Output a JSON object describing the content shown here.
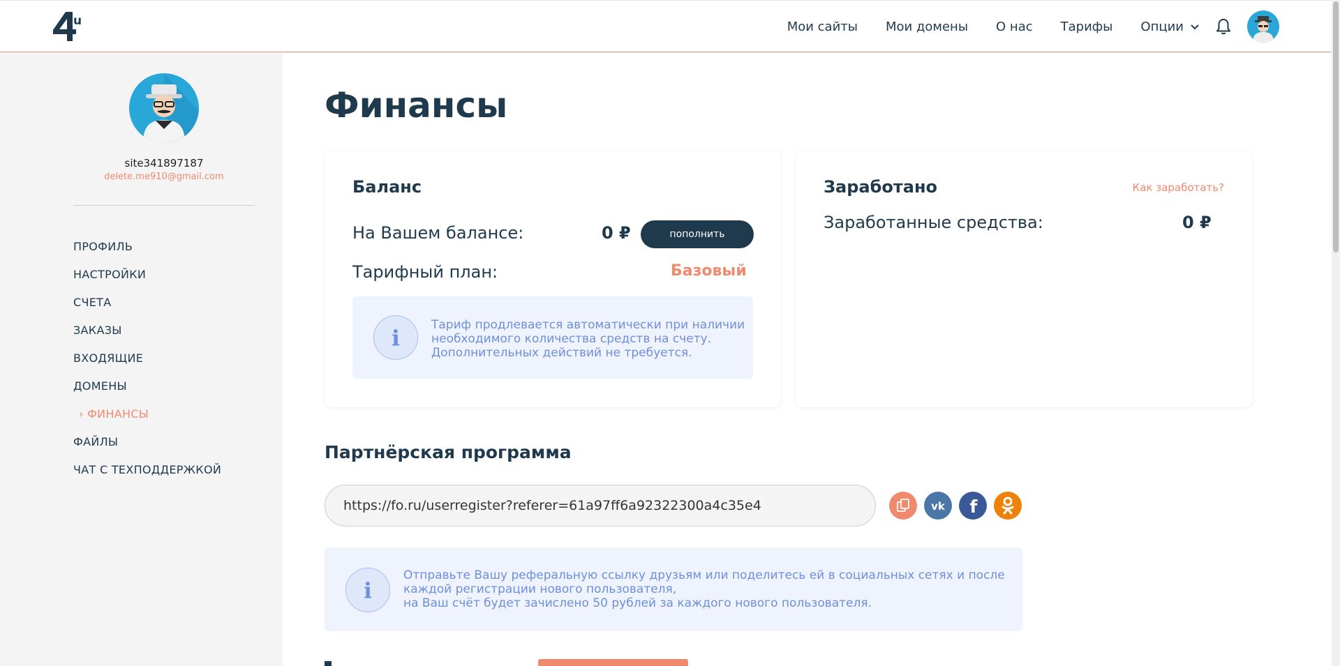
{
  "header": {
    "nav": [
      {
        "label": "Мои сайты"
      },
      {
        "label": "Мои домены"
      },
      {
        "label": "О нас"
      },
      {
        "label": "Тарифы"
      },
      {
        "label": "Опции"
      }
    ],
    "accent": "#ef8a6f",
    "dark": "#1f3a4d"
  },
  "sidebar": {
    "username": "site341897187",
    "email": "delete.me910@gmail.com",
    "menu": [
      {
        "label": "ПРОФИЛЬ"
      },
      {
        "label": "НАСТРОЙКИ"
      },
      {
        "label": "СЧЕТА"
      },
      {
        "label": "ЗАКАЗЫ"
      },
      {
        "label": "ВХОДЯЩИЕ"
      },
      {
        "label": "ДОМЕНЫ"
      },
      {
        "label": "› ФИНАНСЫ",
        "active": true
      },
      {
        "label": "ФАЙЛЫ"
      },
      {
        "label": "ЧАТ С ТЕХПОДДЕРЖКОЙ"
      }
    ]
  },
  "main": {
    "title": "Финансы",
    "balance": {
      "title": "Баланс",
      "balance_label": "На Вашем балансе:",
      "balance_value": "0 ₽",
      "topup_label": "пополнить",
      "plan_label": "Тарифный план:",
      "plan_value": "Базовый",
      "info_lines": [
        "Тариф продлевается автоматически при наличии",
        "необходимого количества средств на счету.",
        "Дополнительных действий не требуется."
      ]
    },
    "earned": {
      "title": "Заработано",
      "link": "Как заработать?",
      "label": "Заработанные средства:",
      "value": "0 ₽"
    },
    "partner": {
      "title": "Партнёрская программа",
      "ref_url": "https://fo.ru/userregister?referer=61a97ff6a92322300a4c35e4",
      "info_lines": [
        "Отправьте Вашу реферальную ссылку друзьям или поделитесь ей в социальных сетях и после",
        "каждой регистрации нового пользователя,",
        "на Ваш счёт будет зачислено 50 рублей за каждого нового пользователя."
      ]
    }
  }
}
